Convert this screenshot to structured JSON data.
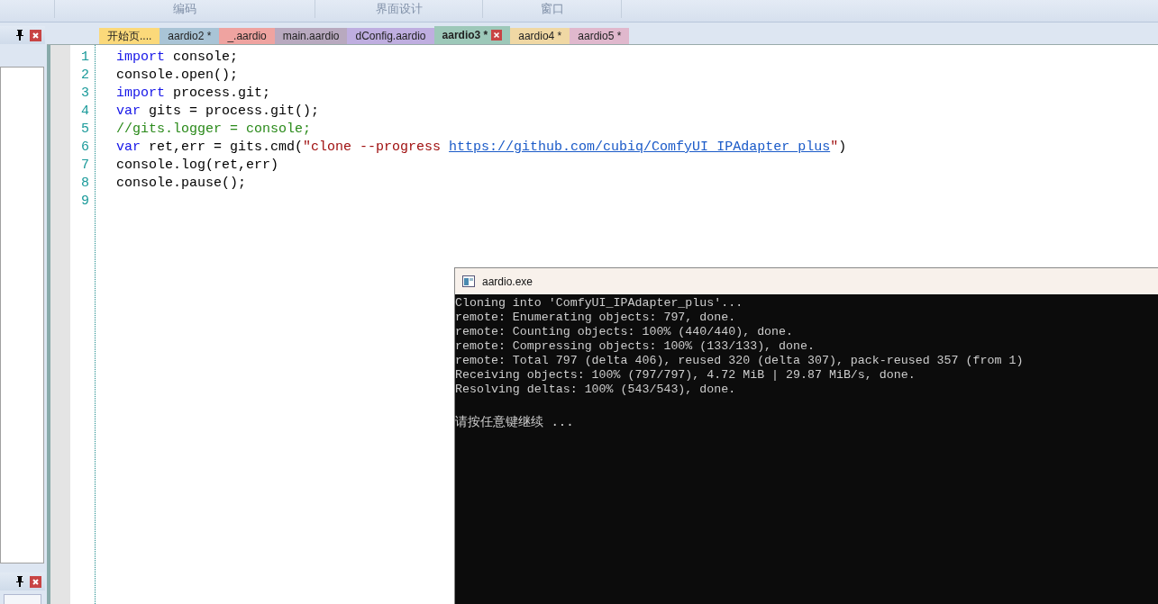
{
  "ribbon": {
    "groups": [
      "编码",
      "界面设计",
      "窗口"
    ]
  },
  "tabs": [
    {
      "label": "开始页....",
      "color": "#fbd97a",
      "selected": false
    },
    {
      "label": "aardio2 *",
      "color": "#a9c4d6",
      "selected": false
    },
    {
      "label": "_.aardio",
      "color": "#efa3a0",
      "selected": false
    },
    {
      "label": "main.aardio",
      "color": "#b8a9bf",
      "selected": false
    },
    {
      "label": "dConfig.aardio",
      "color": "#bfaee0",
      "selected": false
    },
    {
      "label": "aardio3 *",
      "color": "#9dc8b9",
      "selected": true
    },
    {
      "label": "aardio4 *",
      "color": "#f0d8a4",
      "selected": false
    },
    {
      "label": "aardio5 *",
      "color": "#e0b8cd",
      "selected": false
    }
  ],
  "editor": {
    "lines": [
      {
        "number": "1",
        "tokens": [
          {
            "kind": "keyword",
            "text": "import"
          },
          {
            "kind": "plain",
            "text": " console;"
          }
        ]
      },
      {
        "number": "2",
        "tokens": [
          {
            "kind": "plain",
            "text": "console.open();"
          }
        ]
      },
      {
        "number": "3",
        "tokens": [
          {
            "kind": "keyword",
            "text": "import"
          },
          {
            "kind": "plain",
            "text": " process.git;"
          }
        ]
      },
      {
        "number": "4",
        "tokens": [
          {
            "kind": "keyword",
            "text": "var"
          },
          {
            "kind": "plain",
            "text": " gits = process.git();"
          }
        ]
      },
      {
        "number": "5",
        "tokens": [
          {
            "kind": "comment",
            "text": "//gits.logger = console;"
          }
        ]
      },
      {
        "number": "6",
        "tokens": [
          {
            "kind": "keyword",
            "text": "var"
          },
          {
            "kind": "plain",
            "text": " ret,err = gits.cmd("
          },
          {
            "kind": "string",
            "text": "\"clone --progress "
          },
          {
            "kind": "link",
            "text": "https://github.com/cubiq/ComfyUI_IPAdapter_plus"
          },
          {
            "kind": "string",
            "text": "\""
          },
          {
            "kind": "plain",
            "text": ")"
          }
        ]
      },
      {
        "number": "7",
        "tokens": [
          {
            "kind": "plain",
            "text": "console.log(ret,err)"
          }
        ]
      },
      {
        "number": "8",
        "tokens": [
          {
            "kind": "plain",
            "text": "console.pause();"
          }
        ]
      },
      {
        "number": "9"
      }
    ]
  },
  "console": {
    "title": "aardio.exe",
    "lines": [
      "Cloning into 'ComfyUI_IPAdapter_plus'...",
      "remote: Enumerating objects: 797, done.",
      "remote: Counting objects: 100% (440/440), done.",
      "remote: Compressing objects: 100% (133/133), done.",
      "remote: Total 797 (delta 406), reused 320 (delta 307), pack-reused 357 (from 1)",
      "Receiving objects: 100% (797/797), 4.72 MiB | 29.87 MiB/s, done.",
      "Resolving deltas: 100% (543/543), done."
    ],
    "prompt": "请按任意键继续 ..."
  }
}
